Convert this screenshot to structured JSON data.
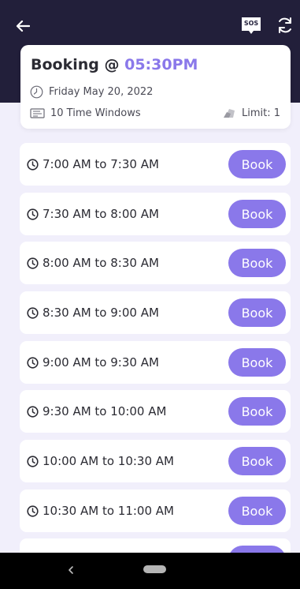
{
  "colors": {
    "accent": "#8a78ea",
    "header_bg": "#221f3a",
    "page_bg": "#f1effb"
  },
  "topbar": {
    "back_icon": "arrow-left-icon",
    "sos_label": "SOS",
    "refresh_icon": "refresh-icon"
  },
  "header": {
    "title_prefix": "Booking @ ",
    "time": "05:30PM",
    "date": "Friday May 20, 2022",
    "windows": "10 Time Windows",
    "limit": "Limit: 1"
  },
  "slots": [
    {
      "time": "7:00 AM to 7:30 AM",
      "button": "Book"
    },
    {
      "time": "7:30 AM to 8:00 AM",
      "button": "Book"
    },
    {
      "time": "8:00 AM to 8:30 AM",
      "button": "Book"
    },
    {
      "time": "8:30 AM to 9:00 AM",
      "button": "Book"
    },
    {
      "time": "9:00 AM to 9:30 AM",
      "button": "Book"
    },
    {
      "time": "9:30 AM to 10:00 AM",
      "button": "Book"
    },
    {
      "time": "10:00 AM to 10:30 AM",
      "button": "Book"
    },
    {
      "time": "10:30 AM to 11:00 AM",
      "button": "Book"
    },
    {
      "time": "",
      "button": ""
    }
  ]
}
